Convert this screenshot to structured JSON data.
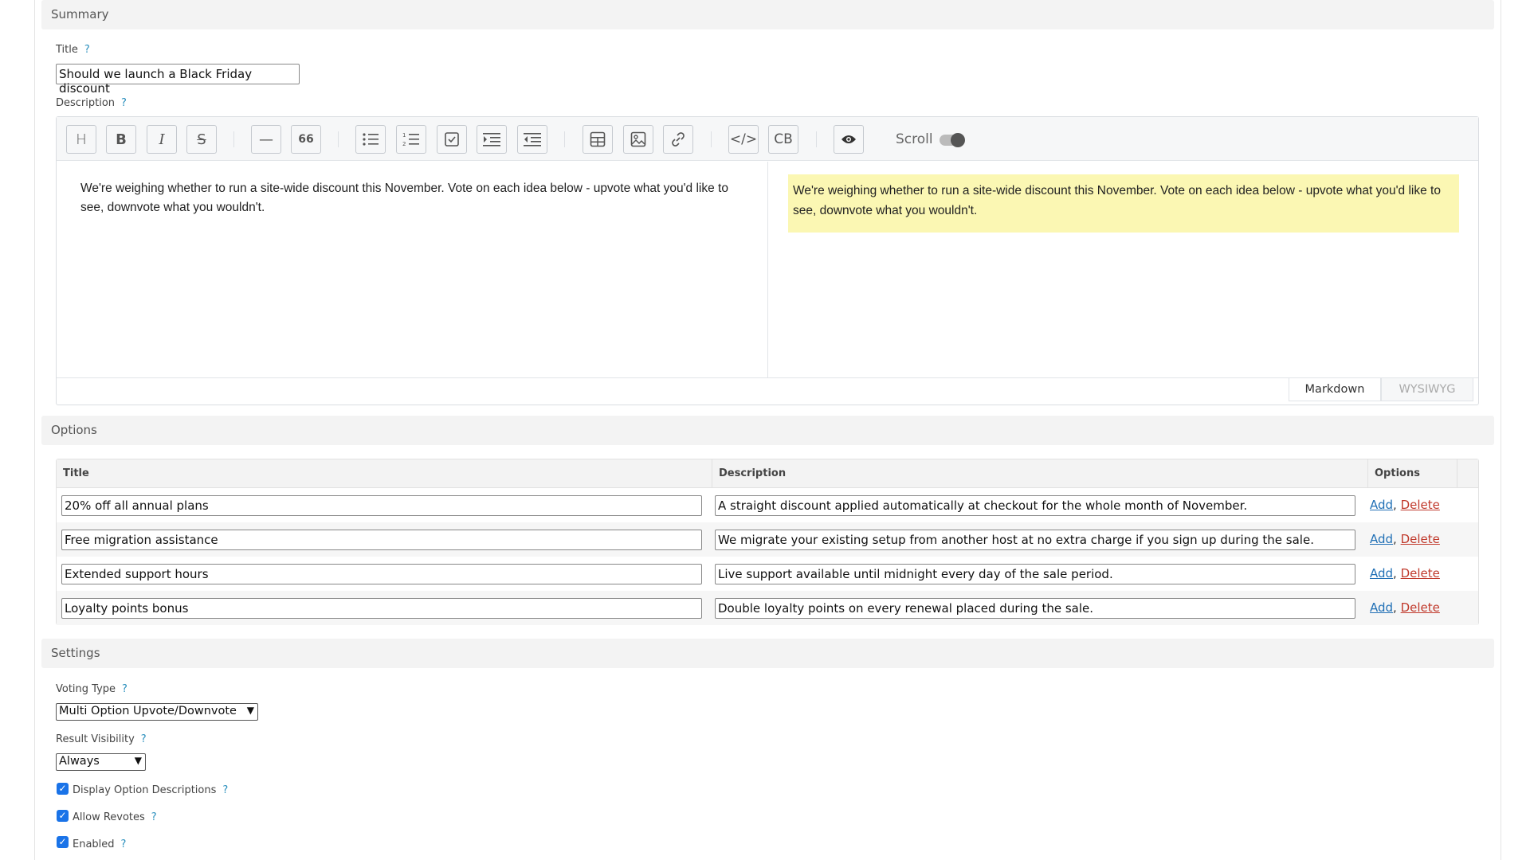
{
  "summary": {
    "heading": "Summary",
    "title_label": "Title",
    "title_value": "Should we launch a Black Friday discount",
    "help": "?",
    "description_label": "Description",
    "editor": {
      "markdown_text": "We're weighing whether to run a site-wide discount this November. Vote on each idea below - upvote what you'd like to see, downvote what you wouldn't.",
      "preview_text": "We're weighing whether to run a site-wide discount this November. Vote on each idea below - upvote what you'd like to see, downvote what you wouldn't.",
      "toolbar": {
        "heading": "H",
        "bold": "B",
        "italic": "I",
        "strike": "S",
        "hr": "—",
        "quote": "66",
        "code": "</>",
        "codeblock": "CB",
        "scroll_label": "Scroll",
        "scroll_on": true
      },
      "mode_markdown": "Markdown",
      "mode_wysiwyg": "WYSIWYG"
    }
  },
  "options": {
    "heading": "Options",
    "columns": [
      "Title",
      "Description",
      "Options"
    ],
    "add_label": "Add",
    "delete_label": "Delete",
    "separator": ",",
    "rows": [
      {
        "title": "20% off all annual plans",
        "description": "A straight discount applied automatically at checkout for the whole month of November."
      },
      {
        "title": "Free migration assistance",
        "description": "We migrate your existing setup from another host at no extra charge if you sign up during the sale."
      },
      {
        "title": "Extended support hours",
        "description": "Live support available until midnight every day of the sale period."
      },
      {
        "title": "Loyalty points bonus",
        "description": "Double loyalty points on every renewal placed during the sale."
      }
    ]
  },
  "settings": {
    "heading": "Settings",
    "voting_type_label": "Voting Type",
    "voting_type_value": "Multi Option Upvote/Downvote",
    "result_visibility_label": "Result Visibility",
    "result_visibility_value": "Always",
    "display_descriptions_label": "Display Option Descriptions",
    "allow_revotes_label": "Allow Revotes",
    "enabled_label": "Enabled",
    "display_descriptions_checked": true,
    "allow_revotes_checked": true,
    "enabled_checked": true
  },
  "colors": {
    "link": "#1f6fb5",
    "delete": "#c0392b",
    "help": "#2a8fbd",
    "preview_highlight": "#fbf7b3",
    "checkbox": "#1a73e8"
  }
}
